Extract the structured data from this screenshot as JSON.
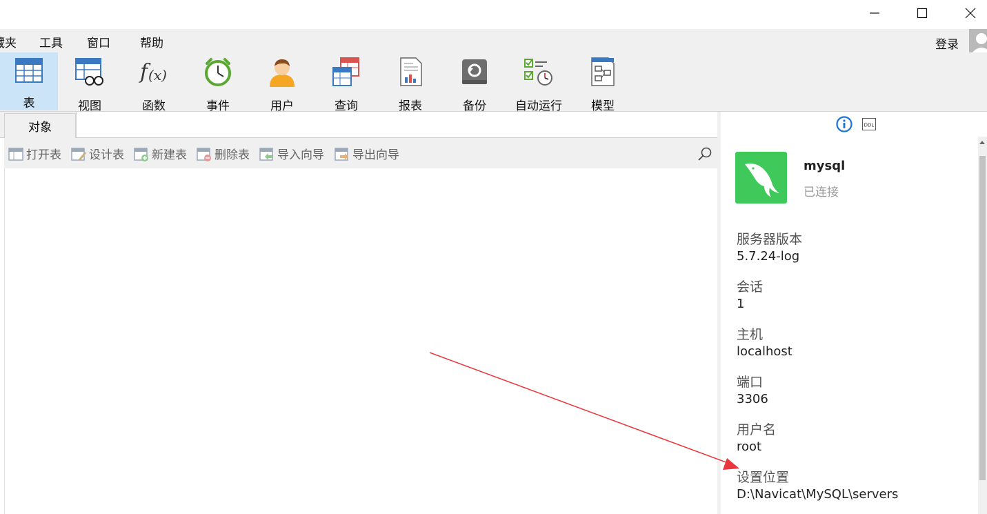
{
  "window": {
    "minimize_icon": "minimize-icon",
    "maximize_icon": "maximize-icon",
    "close_icon": "close-icon"
  },
  "menu": {
    "items": [
      {
        "label": "藏夹"
      },
      {
        "label": "工具"
      },
      {
        "label": "窗口"
      },
      {
        "label": "帮助"
      }
    ],
    "login_label": "登录"
  },
  "toolbar": {
    "items": [
      {
        "label": "表",
        "icon": "table-icon",
        "active": true
      },
      {
        "label": "视图",
        "icon": "view-icon"
      },
      {
        "label": "函数",
        "icon": "function-icon"
      },
      {
        "label": "事件",
        "icon": "event-clock-icon"
      },
      {
        "label": "用户",
        "icon": "user-icon"
      },
      {
        "label": "查询",
        "icon": "query-icon"
      },
      {
        "label": "报表",
        "icon": "report-icon"
      },
      {
        "label": "备份",
        "icon": "backup-icon"
      },
      {
        "label": "自动运行",
        "icon": "autorun-icon"
      },
      {
        "label": "模型",
        "icon": "model-icon"
      }
    ]
  },
  "tabs": {
    "active_label": "对象"
  },
  "object_toolbar": {
    "buttons": [
      {
        "label": "打开表",
        "icon": "open-table-icon"
      },
      {
        "label": "设计表",
        "icon": "design-table-icon"
      },
      {
        "label": "新建表",
        "icon": "new-table-icon"
      },
      {
        "label": "删除表",
        "icon": "delete-table-icon"
      },
      {
        "label": "导入向导",
        "icon": "import-wizard-icon"
      },
      {
        "label": "导出向导",
        "icon": "export-wizard-icon"
      }
    ],
    "search_icon": "search-icon"
  },
  "info_panel": {
    "info_icon": "info-icon",
    "ddl_label": "DDL",
    "connection": {
      "name": "mysql",
      "status": "已连接",
      "logo_color": "#3fc95a"
    },
    "properties": [
      {
        "label": "服务器版本",
        "value": "5.7.24-log"
      },
      {
        "label": "会话",
        "value": "1"
      },
      {
        "label": "主机",
        "value": "localhost"
      },
      {
        "label": "端口",
        "value": "3306"
      },
      {
        "label": "用户名",
        "value": "root"
      },
      {
        "label": "设置位置",
        "value": "D:\\Navicat\\MySQL\\servers"
      }
    ]
  },
  "annotation": {
    "arrow_color": "#e8383d"
  }
}
